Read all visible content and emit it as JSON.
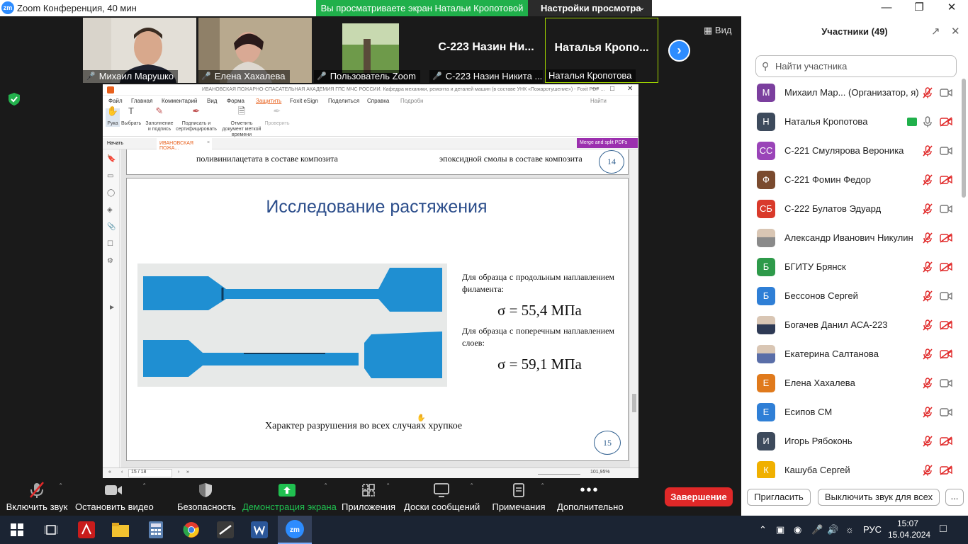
{
  "titlebar": {
    "app_title": "Zoom Конференция, 40 мин",
    "logo": "zm",
    "share_banner": "Вы просматриваете экран Натальи Кропотовой",
    "view_settings": "Настройки просмотра"
  },
  "videos": [
    {
      "name": "Михаил Марушко"
    },
    {
      "name": "Елена Хахалева"
    },
    {
      "name": "Пользователь Zoom"
    },
    {
      "name": "С-223 Назин Никита ...",
      "big": "С-223 Назин Ни..."
    },
    {
      "name": "Наталья Кропотова",
      "big": "Наталья Кропо..."
    }
  ],
  "view_button": "Вид",
  "foxit": {
    "title": "ИВАНОВСКАЯ ПОЖАРНО-СПАСАТЕЛЬНАЯ АКАДЕМИЯ ГПС МЧС РОССИИ. Кафедра механики, ремонта и деталей машин (в составе УНК «Пожаротушение») - Foxit PDF ...",
    "menu": [
      "Файл",
      "Главная",
      "Комментарий",
      "Вид",
      "Форма",
      "Защитить",
      "Foxit eSign",
      "Поделиться",
      "Справка",
      "Подробн"
    ],
    "find": "Найти",
    "ribbon": [
      "Рука",
      "Выбрать",
      "Заполнение и подпись",
      "Подписать и сертифицировать",
      "Отметить документ меткой времени",
      "Проверить"
    ],
    "tabs": [
      "Начать",
      "ИВАНОВСКАЯ ПОЖА..."
    ],
    "merge_button": "Merge and split PDFs",
    "page_prev": {
      "left_text": "поливинилацетата в составе композита",
      "right_text": "эпоксидной смолы в составе композита",
      "number": "14"
    },
    "page": {
      "title": "Исследование растяжения",
      "text1": "Для образца с продольным наплавлением филамента:",
      "formula1": "σ = 55,4 МПа",
      "text2": "Для образца с поперечным наплавлением слоев:",
      "formula2": "σ = 59,1 МПа",
      "conclusion": "Характер разрушения во всех случаях хрупкое",
      "number": "15"
    },
    "status": {
      "page_nav": "15 / 18",
      "zoom": "101,95%"
    }
  },
  "controls": [
    "Включить звук",
    "Остановить видео",
    "Безопасность",
    "Демонстрация экрана",
    "Приложения",
    "Доски сообщений",
    "Примечания",
    "Дополнительно"
  ],
  "end_button": "Завершение",
  "panel": {
    "title": "Участники (49)",
    "search_placeholder": "Найти участника",
    "participants": [
      {
        "name": "Михаил Мар... (Организатор, я)",
        "initials": "М",
        "color": "#7b3f9e",
        "mic": "muted",
        "cam": "on"
      },
      {
        "name": "Наталья Кропотова",
        "initials": "Н",
        "color": "#3d4a5c",
        "mic": "on",
        "cam": "off",
        "sharing": true
      },
      {
        "name": "С-221 Смулярова Вероника",
        "initials": "СС",
        "color": "#9a44b8",
        "mic": "muted",
        "cam": "on"
      },
      {
        "name": "С-221 Фомин Федор",
        "initials": "Ф",
        "color": "#7a4a2e",
        "mic": "muted",
        "cam": "off"
      },
      {
        "name": "С-222 Булатов Эдуард",
        "initials": "СБ",
        "color": "#d93a2b",
        "mic": "muted",
        "cam": "on"
      },
      {
        "name": "Александр Иванович Никулин",
        "initials": "",
        "color": "#8a8a8a",
        "mic": "muted",
        "cam": "off",
        "photo": true
      },
      {
        "name": "БГИТУ Брянск",
        "initials": "Б",
        "color": "#2e9a4a",
        "mic": "muted",
        "cam": "off"
      },
      {
        "name": "Бессонов Сергей",
        "initials": "Б",
        "color": "#2f7fd6",
        "mic": "muted",
        "cam": "on"
      },
      {
        "name": "Богачев Данил АСА-223",
        "initials": "",
        "color": "#2e3a55",
        "mic": "muted",
        "cam": "off",
        "photo": true
      },
      {
        "name": "Екатерина Салтанова",
        "initials": "",
        "color": "#5a6ea8",
        "mic": "muted",
        "cam": "off",
        "photo": true
      },
      {
        "name": "Елена Хахалева",
        "initials": "Е",
        "color": "#e07a1c",
        "mic": "muted",
        "cam": "on"
      },
      {
        "name": "Есипов СМ",
        "initials": "Е",
        "color": "#2f7fd6",
        "mic": "muted",
        "cam": "on"
      },
      {
        "name": "Игорь Рябоконь",
        "initials": "И",
        "color": "#3d4a5c",
        "mic": "muted",
        "cam": "off"
      },
      {
        "name": "Кашуба Сергей",
        "initials": "К",
        "color": "#f0b000",
        "mic": "muted",
        "cam": "off"
      }
    ],
    "invite": "Пригласить",
    "mute_all": "Выключить звук для всех",
    "more": "..."
  },
  "taskbar": {
    "lang": "РУС",
    "time": "15:07",
    "date": "15.04.2024"
  }
}
